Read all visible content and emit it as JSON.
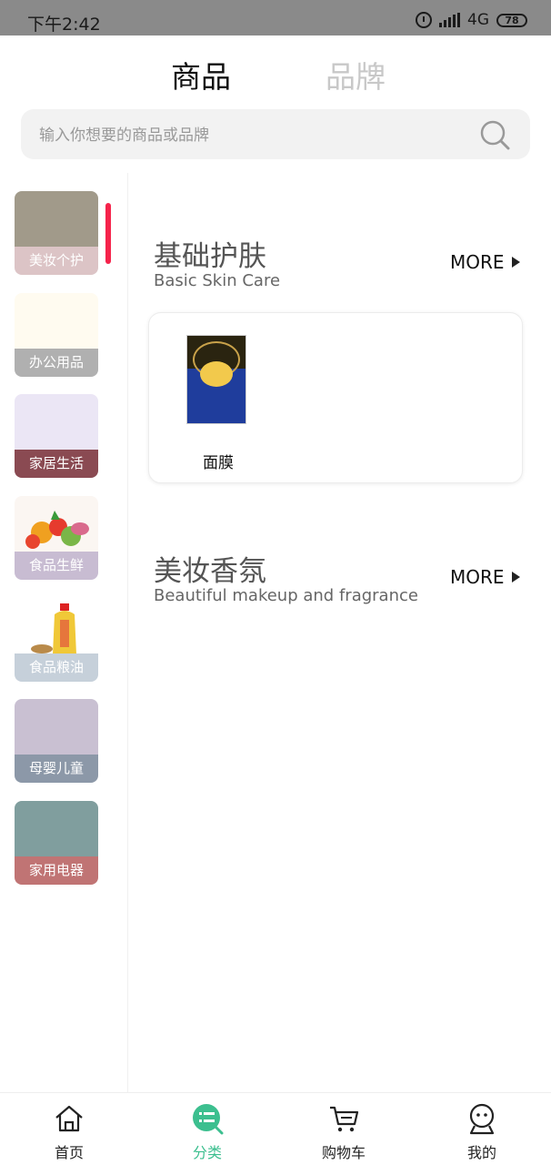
{
  "status_bar": {
    "time": "下午2:42",
    "network": "4G",
    "battery": "78"
  },
  "top_tabs": [
    {
      "label": "商品",
      "active": true
    },
    {
      "label": "品牌",
      "active": false
    }
  ],
  "search": {
    "placeholder": "输入你想要的商品或品牌",
    "value": ""
  },
  "sidebar": {
    "items": [
      {
        "label": "美妆个护",
        "thumb_color": "#a19a8a",
        "label_bg": "#dcc4c6",
        "active": true
      },
      {
        "label": "办公用品",
        "thumb_color": "#fffbf0",
        "label_bg": "#b0b0b0"
      },
      {
        "label": "家居生活",
        "thumb_color": "#ebe6f5",
        "label_bg": "#8a4a52"
      },
      {
        "label": "食品生鲜",
        "thumb_color": "#fbf6f2",
        "label_bg": "#c8bcd2"
      },
      {
        "label": "食品粮油",
        "thumb_color": "#ffffff",
        "label_bg": "#c6d0da"
      },
      {
        "label": "母婴儿童",
        "thumb_color": "#c9c0d2",
        "label_bg": "#8c98a8"
      },
      {
        "label": "家用电器",
        "thumb_color": "#809e9e",
        "label_bg": "#c07474"
      }
    ]
  },
  "sections": [
    {
      "title": "基础护肤",
      "subtitle": "Basic Skin Care",
      "more_label": "MORE",
      "products": [
        {
          "name": "面膜",
          "icon": "face-mask-product"
        }
      ]
    },
    {
      "title": "美妆香氛",
      "subtitle": "Beautiful makeup and fragrance",
      "more_label": "MORE",
      "products": []
    }
  ],
  "bottom_nav": [
    {
      "label": "首页",
      "icon": "home-icon"
    },
    {
      "label": "分类",
      "icon": "category-icon",
      "active": true
    },
    {
      "label": "购物车",
      "icon": "cart-icon"
    },
    {
      "label": "我的",
      "icon": "profile-icon"
    }
  ],
  "colors": {
    "accent": "#3cbf8f",
    "indicator": "#f5234b",
    "status_bar": "#8a8a8a"
  }
}
